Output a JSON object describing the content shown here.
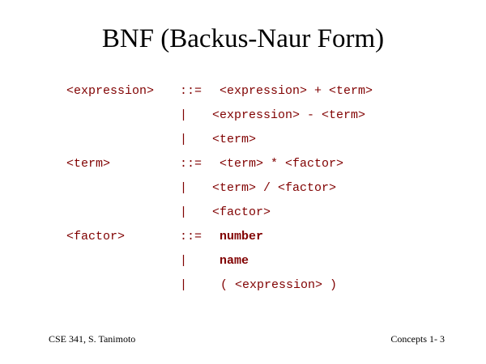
{
  "slide": {
    "title": "BNF (Backus-Naur Form)",
    "rules": [
      {
        "lhs": "<expression>",
        "op": "::=",
        "rhs": "<expression> + <term>",
        "bold": false
      },
      {
        "lhs": "",
        "op": "|",
        "rhs": "<expression> - <term>",
        "bold": false
      },
      {
        "lhs": "",
        "op": "|",
        "rhs": "<term>",
        "bold": false
      },
      {
        "lhs": "<term>",
        "op": "::=",
        "rhs": "<term> * <factor>",
        "bold": false
      },
      {
        "lhs": "",
        "op": "|",
        "rhs": "<term> / <factor>",
        "bold": false
      },
      {
        "lhs": "",
        "op": "|",
        "rhs": "<factor>",
        "bold": false
      },
      {
        "lhs": "<factor>",
        "op": "::=",
        "rhs": "number",
        "bold": true
      },
      {
        "lhs": "",
        "op": "|",
        "rhs": "name",
        "bold": true
      },
      {
        "lhs": "",
        "op": "|",
        "rhs": "( <expression> )",
        "bold": false
      }
    ],
    "footer_left": "CSE 341, S. Tanimoto",
    "footer_right": "Concepts 1- 3"
  },
  "colors": {
    "grammar_text": "#800000",
    "title_text": "#000000",
    "background": "#ffffff"
  }
}
